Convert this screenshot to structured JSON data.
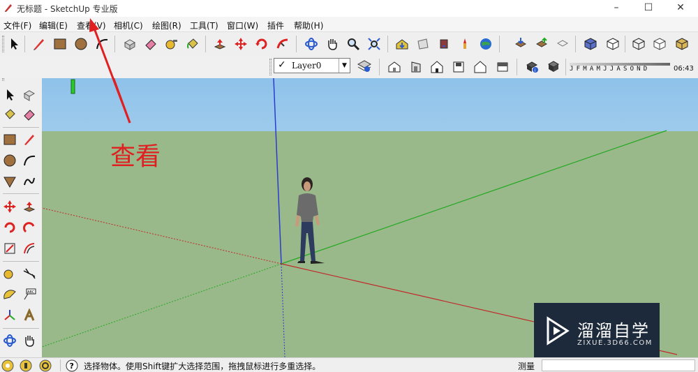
{
  "window": {
    "title": "无标题 - SketchUp 专业版",
    "controls": [
      "–",
      "☐",
      "✕"
    ]
  },
  "menu": [
    "文件(F)",
    "编辑(E)",
    "查看(V)",
    "相机(C)",
    "绘图(R)",
    "工具(T)",
    "窗口(W)",
    "插件",
    "帮助(H)"
  ],
  "layers": {
    "current": "Layer0"
  },
  "shadow": {
    "months": "JFMAMJJASOND",
    "time": "06:43"
  },
  "annotation": {
    "text": "查看"
  },
  "status": {
    "message": "选择物体。使用Shift键扩大选择范围，拖拽鼠标进行多重选择。",
    "measure_label": "测量"
  },
  "watermark": {
    "title": "溜溜自学",
    "subtitle": "ZIXUE.3D66.COM"
  },
  "colors": {
    "axis_red": "#c0282a",
    "axis_green": "#22a822",
    "axis_blue": "#2b3bd0",
    "annotation": "#e02020"
  }
}
